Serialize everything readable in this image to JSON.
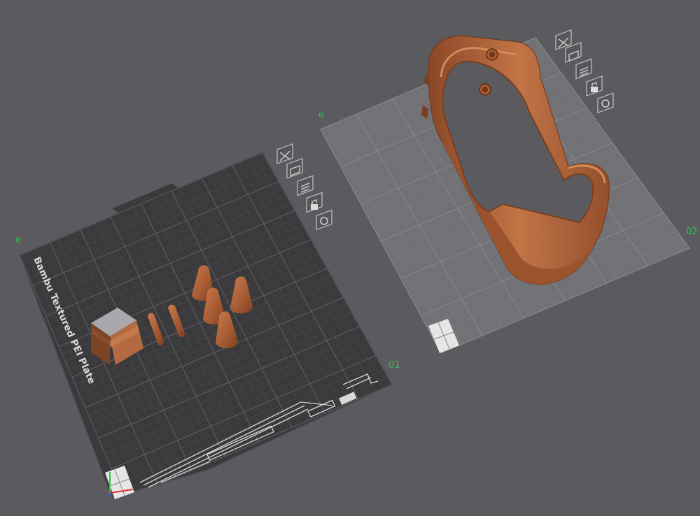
{
  "viewport": {
    "background": "#5b5b5f"
  },
  "plate1": {
    "number": "01",
    "texture_label": "Bambu Textured PEI Plate",
    "edit_glyph": "e",
    "plate_color": "#3a3a3d",
    "icons": [
      "close-icon",
      "arrange-icon",
      "slice-plate-icon",
      "lock-icon",
      "settings-icon"
    ]
  },
  "plate2": {
    "number": "02",
    "edit_glyph": "e",
    "plate_color": "#6c6c70",
    "icons": [
      "close-icon",
      "arrange-icon",
      "slice-plate-icon",
      "lock-icon",
      "settings-icon"
    ]
  },
  "model_color": "#b0653e"
}
